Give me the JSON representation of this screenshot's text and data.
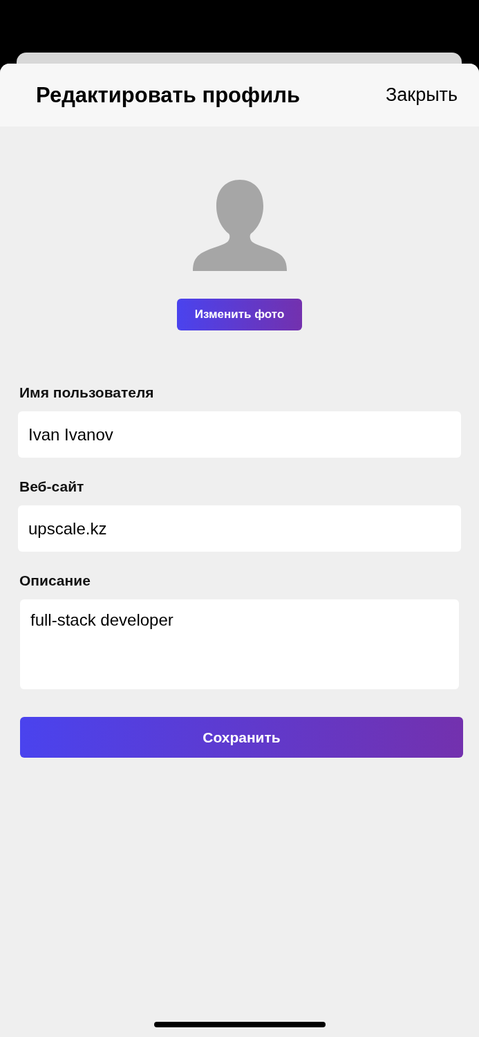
{
  "header": {
    "title": "Редактировать профиль",
    "close": "Закрыть"
  },
  "avatar": {
    "change_photo": "Изменить фото"
  },
  "fields": [
    {
      "kind": "input",
      "label": "Имя пользователя",
      "value": "Ivan Ivanov"
    },
    {
      "kind": "input",
      "label": "Веб-сайт",
      "value": "upscale.kz"
    },
    {
      "kind": "textarea",
      "label": "Описание",
      "value": "full-stack developer"
    }
  ],
  "save": "Сохранить"
}
